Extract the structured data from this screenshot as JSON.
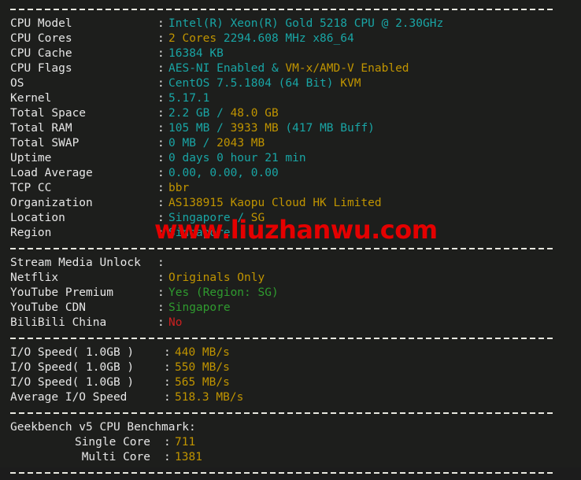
{
  "terminal": {
    "watermark": "www.liuzhanwu.com",
    "colors": {
      "background": "#1d1e1c",
      "label": "#e6e6e6",
      "cyan": "#19a5a5",
      "yellow": "#c09400",
      "green": "#2f9b2f",
      "red": "#cc2020",
      "watermark": "#e40000"
    }
  },
  "system_info": {
    "rows": [
      {
        "label": "CPU Model",
        "segments": [
          {
            "text": "Intel(R) Xeon(R) Gold 5218 CPU @ 2.30GHz",
            "color": "cyan"
          }
        ]
      },
      {
        "label": "CPU Cores",
        "segments": [
          {
            "text": "2 Cores",
            "color": "yellow"
          },
          {
            "text": " ",
            "color": "white"
          },
          {
            "text": "2294.608 MHz x86_64",
            "color": "cyan"
          }
        ]
      },
      {
        "label": "CPU Cache",
        "segments": [
          {
            "text": "16384 KB",
            "color": "cyan"
          }
        ]
      },
      {
        "label": "CPU Flags",
        "segments": [
          {
            "text": "AES-NI Enabled & ",
            "color": "cyan"
          },
          {
            "text": "VM-x/AMD-V Enabled",
            "color": "yellow"
          }
        ]
      },
      {
        "label": "OS",
        "segments": [
          {
            "text": "CentOS 7.5.1804 (64 Bit) ",
            "color": "cyan"
          },
          {
            "text": "KVM",
            "color": "yellow"
          }
        ]
      },
      {
        "label": "Kernel",
        "segments": [
          {
            "text": "5.17.1",
            "color": "cyan"
          }
        ]
      },
      {
        "label": "Total Space",
        "segments": [
          {
            "text": "2.2 GB ",
            "color": "cyan"
          },
          {
            "text": "/ ",
            "color": "cyan"
          },
          {
            "text": "48.0 GB",
            "color": "yellow"
          }
        ]
      },
      {
        "label": "Total RAM",
        "segments": [
          {
            "text": "105 MB ",
            "color": "cyan"
          },
          {
            "text": "/ ",
            "color": "cyan"
          },
          {
            "text": "3933 MB ",
            "color": "yellow"
          },
          {
            "text": "(417 MB Buff)",
            "color": "cyan"
          }
        ]
      },
      {
        "label": "Total SWAP",
        "segments": [
          {
            "text": "0 MB ",
            "color": "cyan"
          },
          {
            "text": "/ ",
            "color": "cyan"
          },
          {
            "text": "2043 MB",
            "color": "yellow"
          }
        ]
      },
      {
        "label": "Uptime",
        "segments": [
          {
            "text": "0 days 0 hour 21 min",
            "color": "cyan"
          }
        ]
      },
      {
        "label": "Load Average",
        "segments": [
          {
            "text": "0.00, 0.00, 0.00",
            "color": "cyan"
          }
        ]
      },
      {
        "label": "TCP CC",
        "segments": [
          {
            "text": "bbr",
            "color": "yellow"
          }
        ]
      },
      {
        "label": "Organization",
        "segments": [
          {
            "text": "AS138915 Kaopu Cloud HK Limited",
            "color": "yellow"
          }
        ]
      },
      {
        "label": "Location",
        "segments": [
          {
            "text": "Singapore ",
            "color": "cyan"
          },
          {
            "text": "/ ",
            "color": "cyan"
          },
          {
            "text": "SG",
            "color": "yellow"
          }
        ]
      },
      {
        "label": "Region",
        "segments": [
          {
            "text": "Singapore",
            "color": "cyan"
          }
        ]
      }
    ]
  },
  "stream_media": {
    "rows": [
      {
        "label": "Stream Media Unlock",
        "segments": []
      },
      {
        "label": "Netflix",
        "segments": [
          {
            "text": "Originals Only",
            "color": "yellow"
          }
        ]
      },
      {
        "label": "YouTube Premium",
        "segments": [
          {
            "text": "Yes (Region: SG)",
            "color": "green"
          }
        ]
      },
      {
        "label": "YouTube CDN",
        "segments": [
          {
            "text": "Singapore",
            "color": "green"
          }
        ]
      },
      {
        "label": "BiliBili China",
        "segments": [
          {
            "text": "No",
            "color": "red"
          }
        ]
      }
    ]
  },
  "io_speed": {
    "rows": [
      {
        "label": "I/O Speed( 1.0GB )",
        "segments": [
          {
            "text": "440 MB/s",
            "color": "yellow"
          }
        ]
      },
      {
        "label": "I/O Speed( 1.0GB )",
        "segments": [
          {
            "text": "550 MB/s",
            "color": "yellow"
          }
        ]
      },
      {
        "label": "I/O Speed( 1.0GB )",
        "segments": [
          {
            "text": "565 MB/s",
            "color": "yellow"
          }
        ]
      },
      {
        "label": "Average I/O Speed",
        "segments": [
          {
            "text": "518.3 MB/s",
            "color": "yellow"
          }
        ]
      }
    ]
  },
  "geekbench": {
    "title": "Geekbench v5 CPU Benchmark:",
    "rows": [
      {
        "label": "Single Core",
        "segments": [
          {
            "text": "711",
            "color": "yellow"
          }
        ]
      },
      {
        "label": "Multi Core",
        "segments": [
          {
            "text": "1381",
            "color": "yellow"
          }
        ]
      }
    ]
  }
}
